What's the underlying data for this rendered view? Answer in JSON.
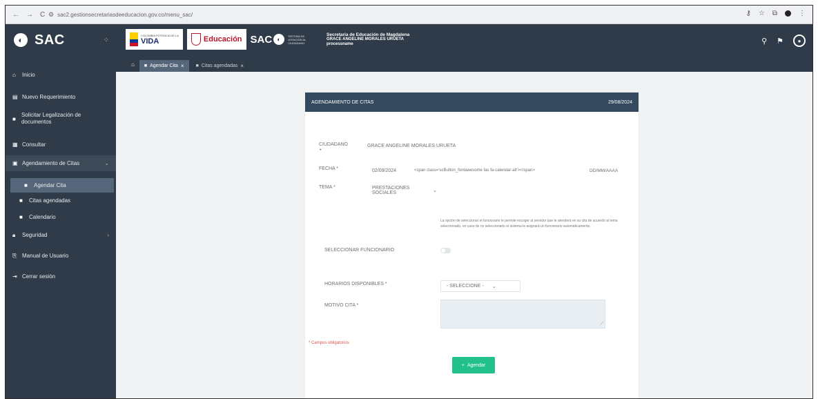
{
  "browser": {
    "url": "sac2.gestionsecretariasdeeducacion.gov.co/menu_sac/",
    "back_icon": "←",
    "forward_icon": "→",
    "reload_icon": "C"
  },
  "sidebar": {
    "brand": "SAC",
    "items": [
      {
        "label": "Inicio"
      },
      {
        "label": "Nuevo Requerimiento"
      },
      {
        "label": "Solicitar Legalización de documentos"
      },
      {
        "label": "Consultar"
      },
      {
        "label": "Agendamiento de Citas"
      },
      {
        "label": "Agendar Cita"
      },
      {
        "label": "Citas agendadas"
      },
      {
        "label": "Calendario"
      },
      {
        "label": "Seguridad"
      },
      {
        "label": "Manual de Usuario"
      },
      {
        "label": "Cerrar sesión"
      }
    ]
  },
  "header": {
    "partner_vida_top": "COLOMBIA POTENCIA DE LA",
    "partner_vida": "VIDA",
    "partner_edu": "Educación",
    "partner_sac": "SAC",
    "partner_sac_sub": "SISTEMA DE ATENCIÓN AL CIUDADANO",
    "secretaria_title": "Secretaria de Educación de Magdalena",
    "secretaria_user": "GRACE ANGELINE MORALES URUETA",
    "secretaria_role": "processname"
  },
  "tabs": [
    {
      "label": "Agendar Cita"
    },
    {
      "label": "Citas agendadas"
    }
  ],
  "form": {
    "title": "AGENDAMIENTO DE CITAS",
    "date": "29/08/2024",
    "ciudadano_label": "CIUDADANO",
    "ciudadano_value": "GRACE ANGELINE MORALES URUETA",
    "fecha_label": "FECHA *",
    "fecha_value": "02/09/2024",
    "fecha_html_artifact": "<span class='scButton_fontawesome fas fa-calendar-alt'></span>",
    "fecha_format": "DD/MM/AAAA",
    "tema_label": "TEMA *",
    "tema_value": "PRESTACIONES SOCIALES",
    "funcionario_note": "La opción de seleccionar el funcionario le permite escoger al servidor que le atenderá en su cita de acuerdo al tema seleccionado, en caso de no seleccionarlo el sistema le asignará un funcionario automáticamente.",
    "funcionario_label": "SELECCIONAR FUNCIONARIO",
    "horarios_label": "HORARIOS DISPONIBLES *",
    "horarios_value": "- SELECCIONE -",
    "motivo_label": "MOTIVO CITA *",
    "required_note": "* Campos obligatorios",
    "submit_label": "Agendar"
  }
}
